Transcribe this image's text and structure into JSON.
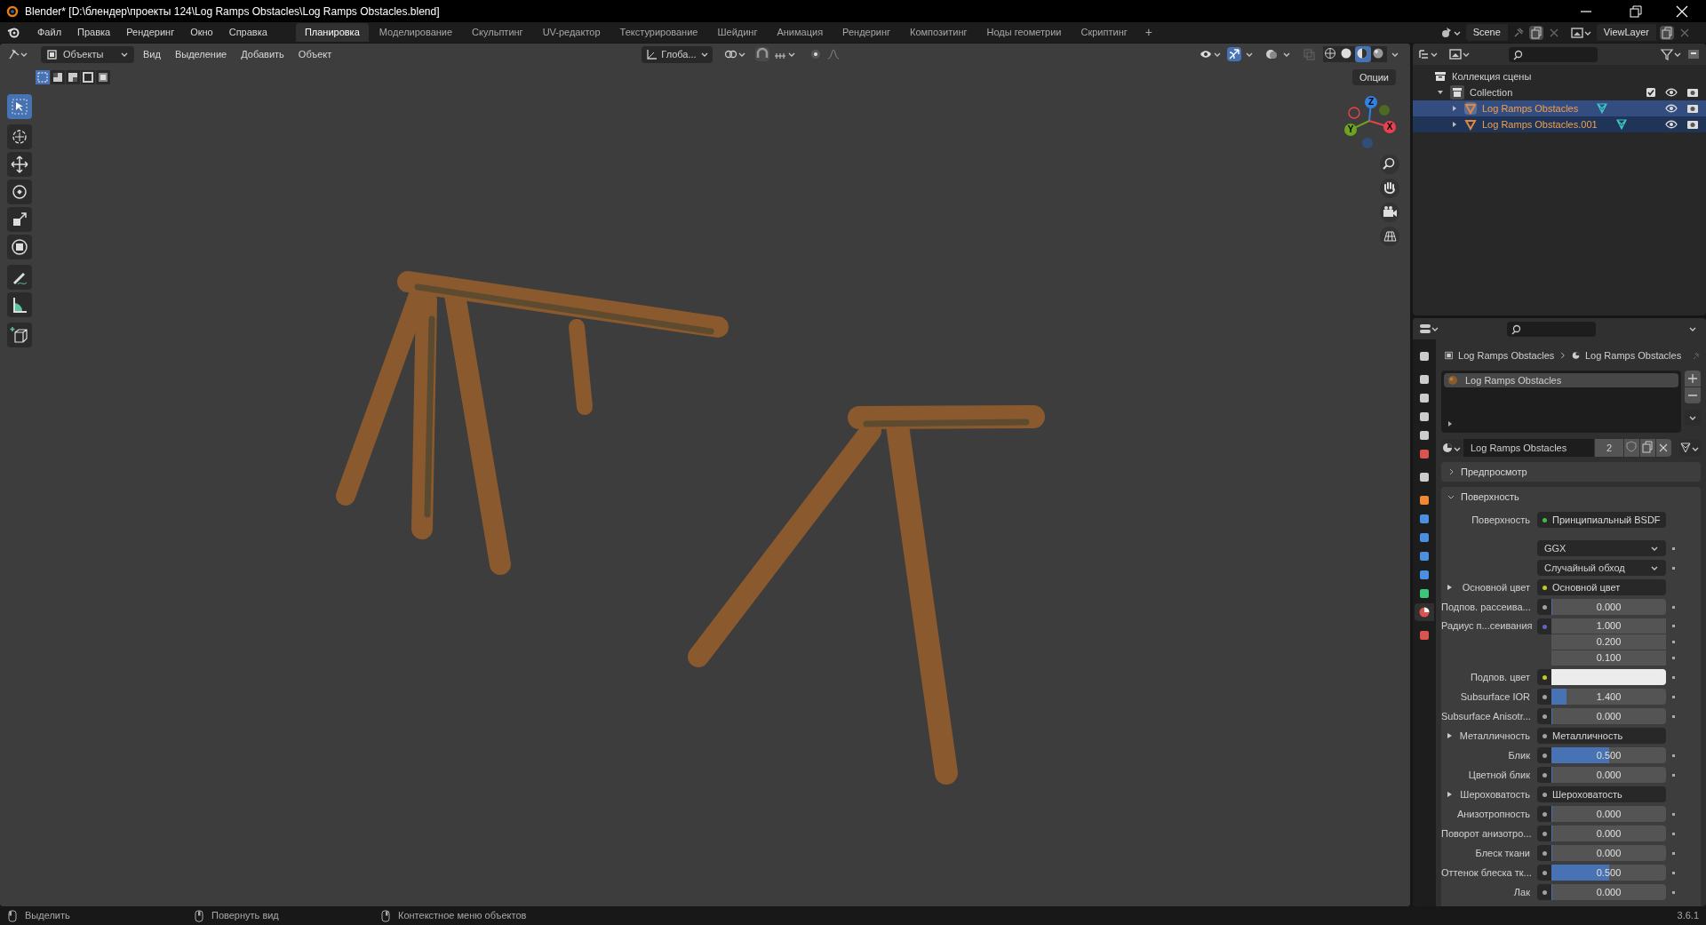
{
  "window": {
    "title": "Blender* [D:\\блендер\\проекты 124\\Log Ramps Obstacles\\Log Ramps Obstacles.blend]"
  },
  "menu": [
    "Файл",
    "Правка",
    "Рендеринг",
    "Окно",
    "Справка"
  ],
  "workspaces": [
    {
      "label": "Планировка",
      "selected": true
    },
    {
      "label": "Моделирование",
      "selected": false
    },
    {
      "label": "Скульптинг",
      "selected": false
    },
    {
      "label": "UV-редактор",
      "selected": false
    },
    {
      "label": "Текстурирование",
      "selected": false
    },
    {
      "label": "Шейдинг",
      "selected": false
    },
    {
      "label": "Анимация",
      "selected": false
    },
    {
      "label": "Рендеринг",
      "selected": false
    },
    {
      "label": "Композитинг",
      "selected": false
    },
    {
      "label": "Ноды геометрии",
      "selected": false
    },
    {
      "label": "Скриптинг",
      "selected": false
    }
  ],
  "add_workspace": "+",
  "scene": "Scene",
  "view_layer": "ViewLayer",
  "viewport": {
    "mode": "Объекты",
    "menus": [
      "Вид",
      "Выделение",
      "Добавить",
      "Объект"
    ],
    "orientation": "Глоба...",
    "options": "Опции",
    "select_modes": [
      {
        "selected": true
      },
      {
        "selected": false
      },
      {
        "selected": false
      },
      {
        "selected": false
      },
      {
        "selected": false
      }
    ],
    "tools": [
      {
        "selected": true
      },
      {
        "selected": false
      },
      {
        "selected": false
      },
      {
        "selected": false
      },
      {
        "selected": false
      },
      {
        "selected": false
      },
      {
        "selected": false
      },
      {
        "selected": false
      },
      {
        "selected": false
      }
    ],
    "shading": [
      {
        "selected": false
      },
      {
        "selected": false
      },
      {
        "selected": true
      },
      {
        "selected": false
      }
    ],
    "gizmo_axes": [
      "Z",
      "Y",
      "X"
    ]
  },
  "outliner": {
    "root": "Коллекция сцены",
    "children": [
      {
        "label": "Collection",
        "expanded": true,
        "checked": true,
        "children": [
          {
            "label": "Log Ramps Obstacles",
            "selected": true,
            "active": true
          },
          {
            "label": "Log Ramps Obstacles.001",
            "selected": true,
            "active": false
          }
        ]
      }
    ]
  },
  "properties": {
    "tabs": [
      {
        "selected": false
      },
      {
        "selected": false
      },
      {
        "selected": false
      },
      {
        "selected": false
      },
      {
        "selected": false
      },
      {
        "selected": false
      },
      {
        "selected": false
      },
      {
        "selected": false
      },
      {
        "selected": false
      },
      {
        "selected": false
      },
      {
        "selected": false
      },
      {
        "selected": false
      },
      {
        "selected": false
      },
      {
        "selected": true
      },
      {
        "selected": false
      }
    ],
    "breadcrumb": [
      "Log Ramps Obstacles",
      "Log Ramps Obstacles"
    ],
    "slots": [
      {
        "label": "Log Ramps Obstacles",
        "selected": true
      }
    ],
    "material": {
      "name": "Log Ramps Obstacles",
      "users": "2"
    },
    "panels": [
      {
        "label": "Предпросмотр",
        "expanded": false
      },
      {
        "label": "Поверхность",
        "expanded": true
      }
    ],
    "rows": [
      {
        "kind": "link",
        "label": "Поверхность",
        "value": "Принципиальный BSDF",
        "color": "#3fbf3f"
      },
      {
        "kind": "enum",
        "value": "GGX"
      },
      {
        "kind": "enum",
        "value": "Случайный обход"
      },
      {
        "kind": "link",
        "label": "Основной цвет",
        "value": "Основной цвет",
        "color": "#c7c729",
        "expandable": true
      },
      {
        "kind": "slider",
        "label": "Подпов. рассеива...",
        "value": "0.000",
        "level": 0,
        "color": "#a1a1a1"
      },
      {
        "kind": "vector",
        "label": "Радиус п...сеивания",
        "values": [
          "1.000",
          "0.200",
          "0.100"
        ],
        "color": "#6363c7"
      },
      {
        "kind": "color",
        "label": "Подпов. цвет",
        "color": "#c7c729"
      },
      {
        "kind": "slider",
        "label": "Subsurface IOR",
        "value": "1.400",
        "level": 0.13,
        "color": "#a1a1a1"
      },
      {
        "kind": "slider",
        "label": "Subsurface Anisotr...",
        "value": "0.000",
        "level": 0,
        "color": "#a1a1a1"
      },
      {
        "kind": "link",
        "label": "Металличность",
        "value": "Металличность",
        "color": "#a1a1a1",
        "expandable": true
      },
      {
        "kind": "slider",
        "label": "Блик",
        "value": "0.500",
        "level": 0.5,
        "color": "#a1a1a1"
      },
      {
        "kind": "slider",
        "label": "Цветной блик",
        "value": "0.000",
        "level": 0,
        "color": "#a1a1a1"
      },
      {
        "kind": "link",
        "label": "Шероховатость",
        "value": "Шероховатость",
        "color": "#a1a1a1",
        "expandable": true
      },
      {
        "kind": "slider",
        "label": "Анизотропность",
        "value": "0.000",
        "level": 0,
        "color": "#a1a1a1"
      },
      {
        "kind": "slider",
        "label": "Поворот анизотро...",
        "value": "0.000",
        "level": 0,
        "color": "#a1a1a1"
      },
      {
        "kind": "slider",
        "label": "Блеск ткани",
        "value": "0.000",
        "level": 0,
        "color": "#a1a1a1"
      },
      {
        "kind": "slider",
        "label": "Оттенок блеска тк...",
        "value": "0.500",
        "level": 0.5,
        "color": "#a1a1a1"
      },
      {
        "kind": "slider",
        "label": "Лак",
        "value": "0.000",
        "level": 0,
        "color": "#a1a1a1"
      }
    ]
  },
  "status_bar": {
    "hints": [
      "Выделить",
      "Повернуть вид",
      "Контекстное меню объектов"
    ],
    "version": "3.6.1"
  }
}
